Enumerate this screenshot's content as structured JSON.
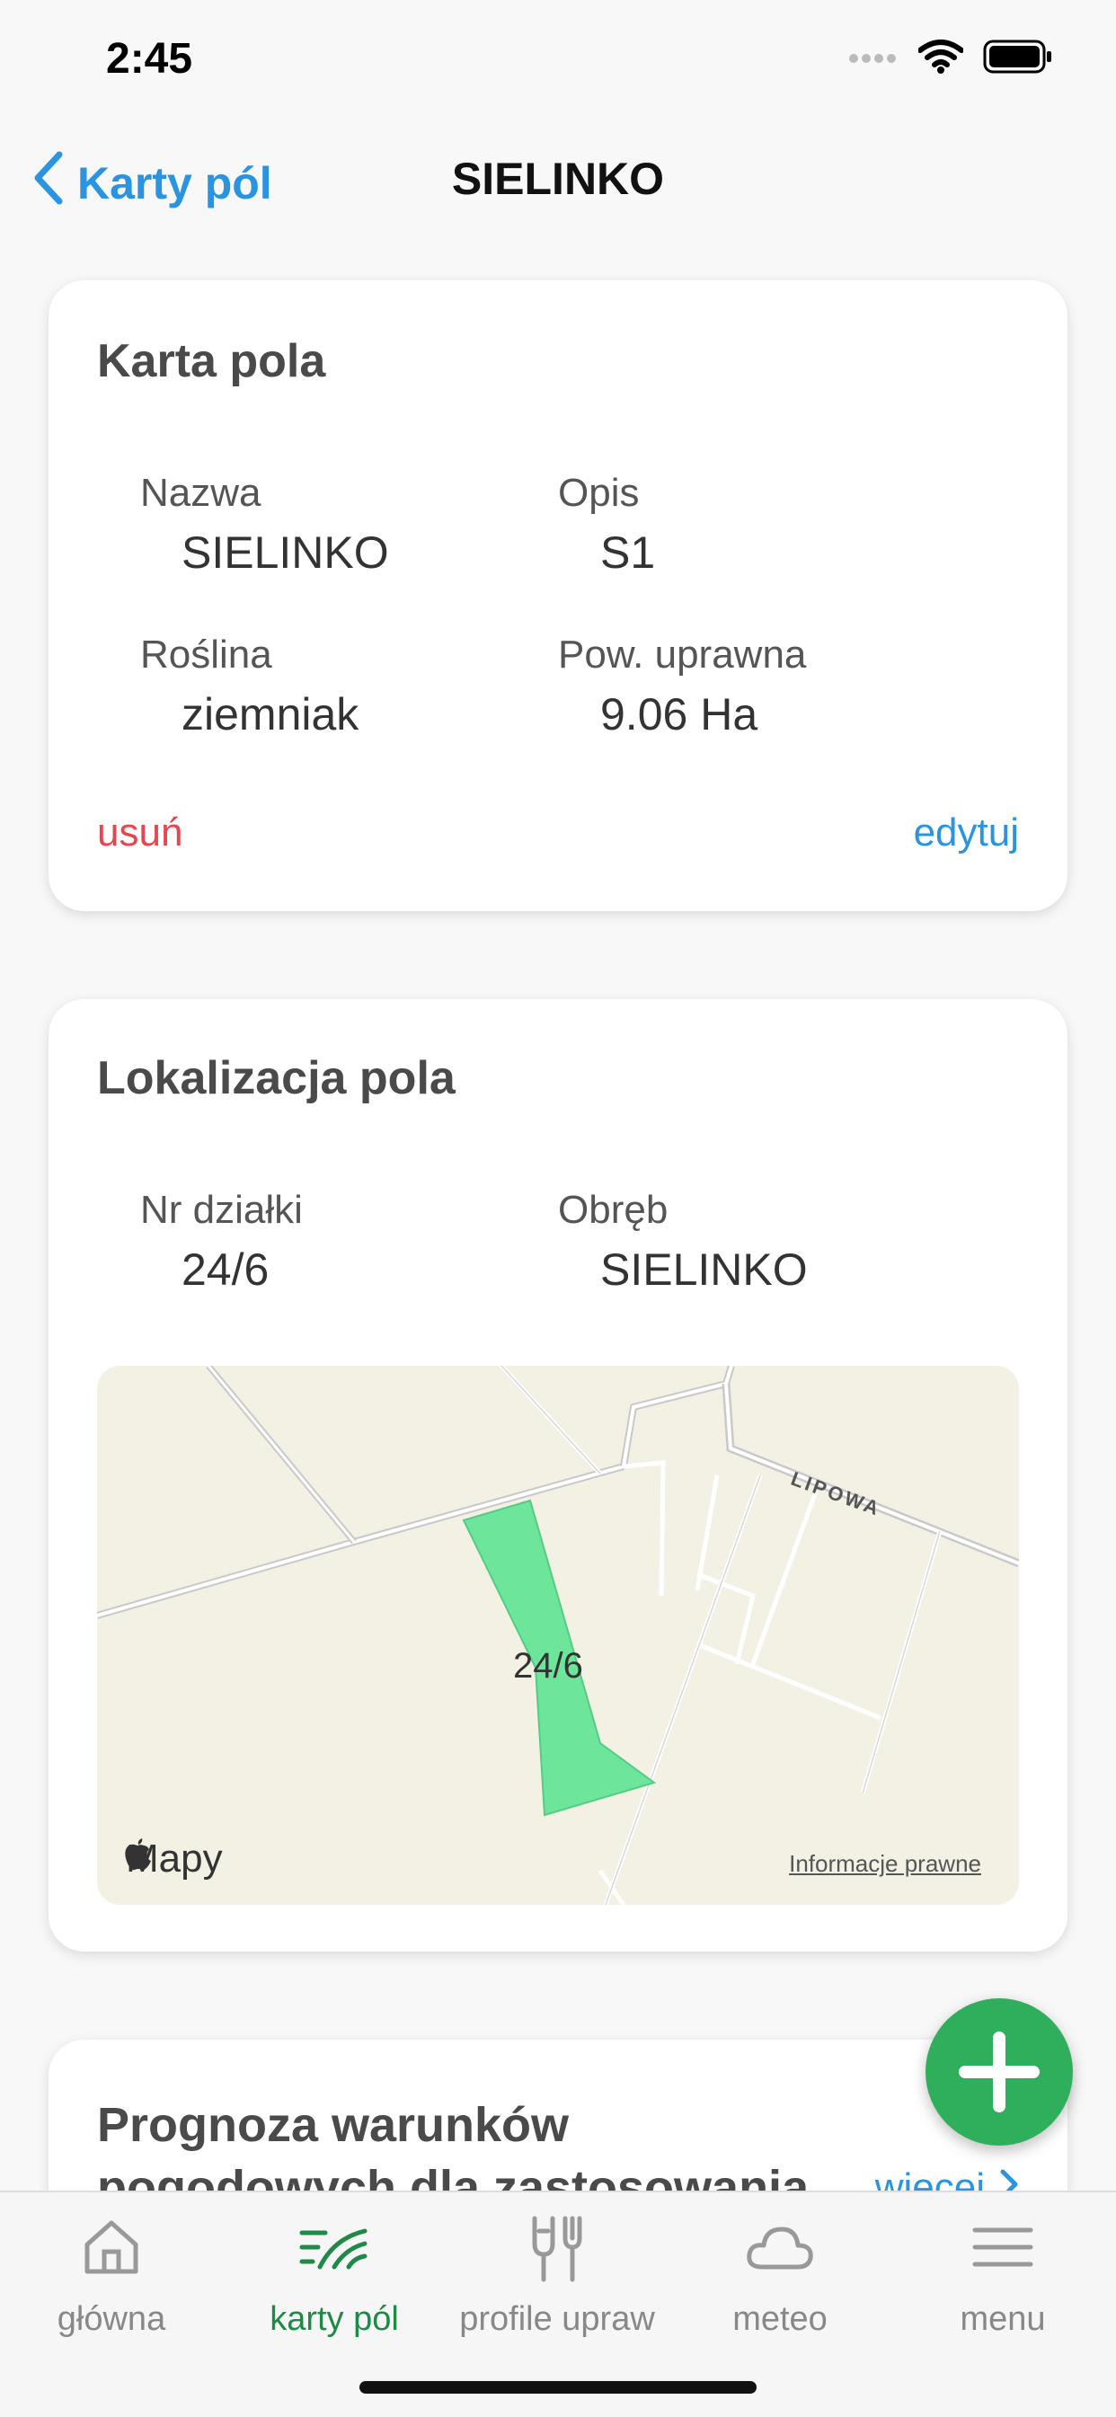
{
  "status": {
    "time": "2:45"
  },
  "nav": {
    "back_label": "Karty pól",
    "title": "SIELINKO"
  },
  "field_card": {
    "title": "Karta pola",
    "name_label": "Nazwa",
    "name_value": "SIELINKO",
    "desc_label": "Opis",
    "desc_value": "S1",
    "crop_label": "Roślina",
    "crop_value": "ziemniak",
    "area_label": "Pow. uprawna",
    "area_value": "9.06 Ha",
    "delete_label": "usuń",
    "edit_label": "edytuj"
  },
  "location_card": {
    "title": "Lokalizacja pola",
    "plot_label": "Nr działki",
    "plot_value": "24/6",
    "precinct_label": "Obręb",
    "precinct_value": "SIELINKO",
    "map": {
      "parcel_label": "24/6",
      "street_label": "LIPOWA",
      "brand": "Mapy",
      "legal": "Informacje prawne"
    }
  },
  "forecast_card": {
    "title": "Prognoza warunków pogodowych dla zastosowania",
    "more_label": "więcej"
  },
  "tabbar": {
    "tabs": [
      {
        "label": "główna",
        "icon": "home-icon",
        "active": false
      },
      {
        "label": "karty pól",
        "icon": "field-icon",
        "active": true
      },
      {
        "label": "profile upraw",
        "icon": "tools-icon",
        "active": false
      },
      {
        "label": "meteo",
        "icon": "cloud-icon",
        "active": false
      },
      {
        "label": "menu",
        "icon": "hamburger-icon",
        "active": false
      }
    ]
  },
  "colors": {
    "accent_blue": "#2b94e0",
    "accent_green": "#2fae5b",
    "delete_red": "#e6474d",
    "parcel_green": "#6de59b"
  }
}
